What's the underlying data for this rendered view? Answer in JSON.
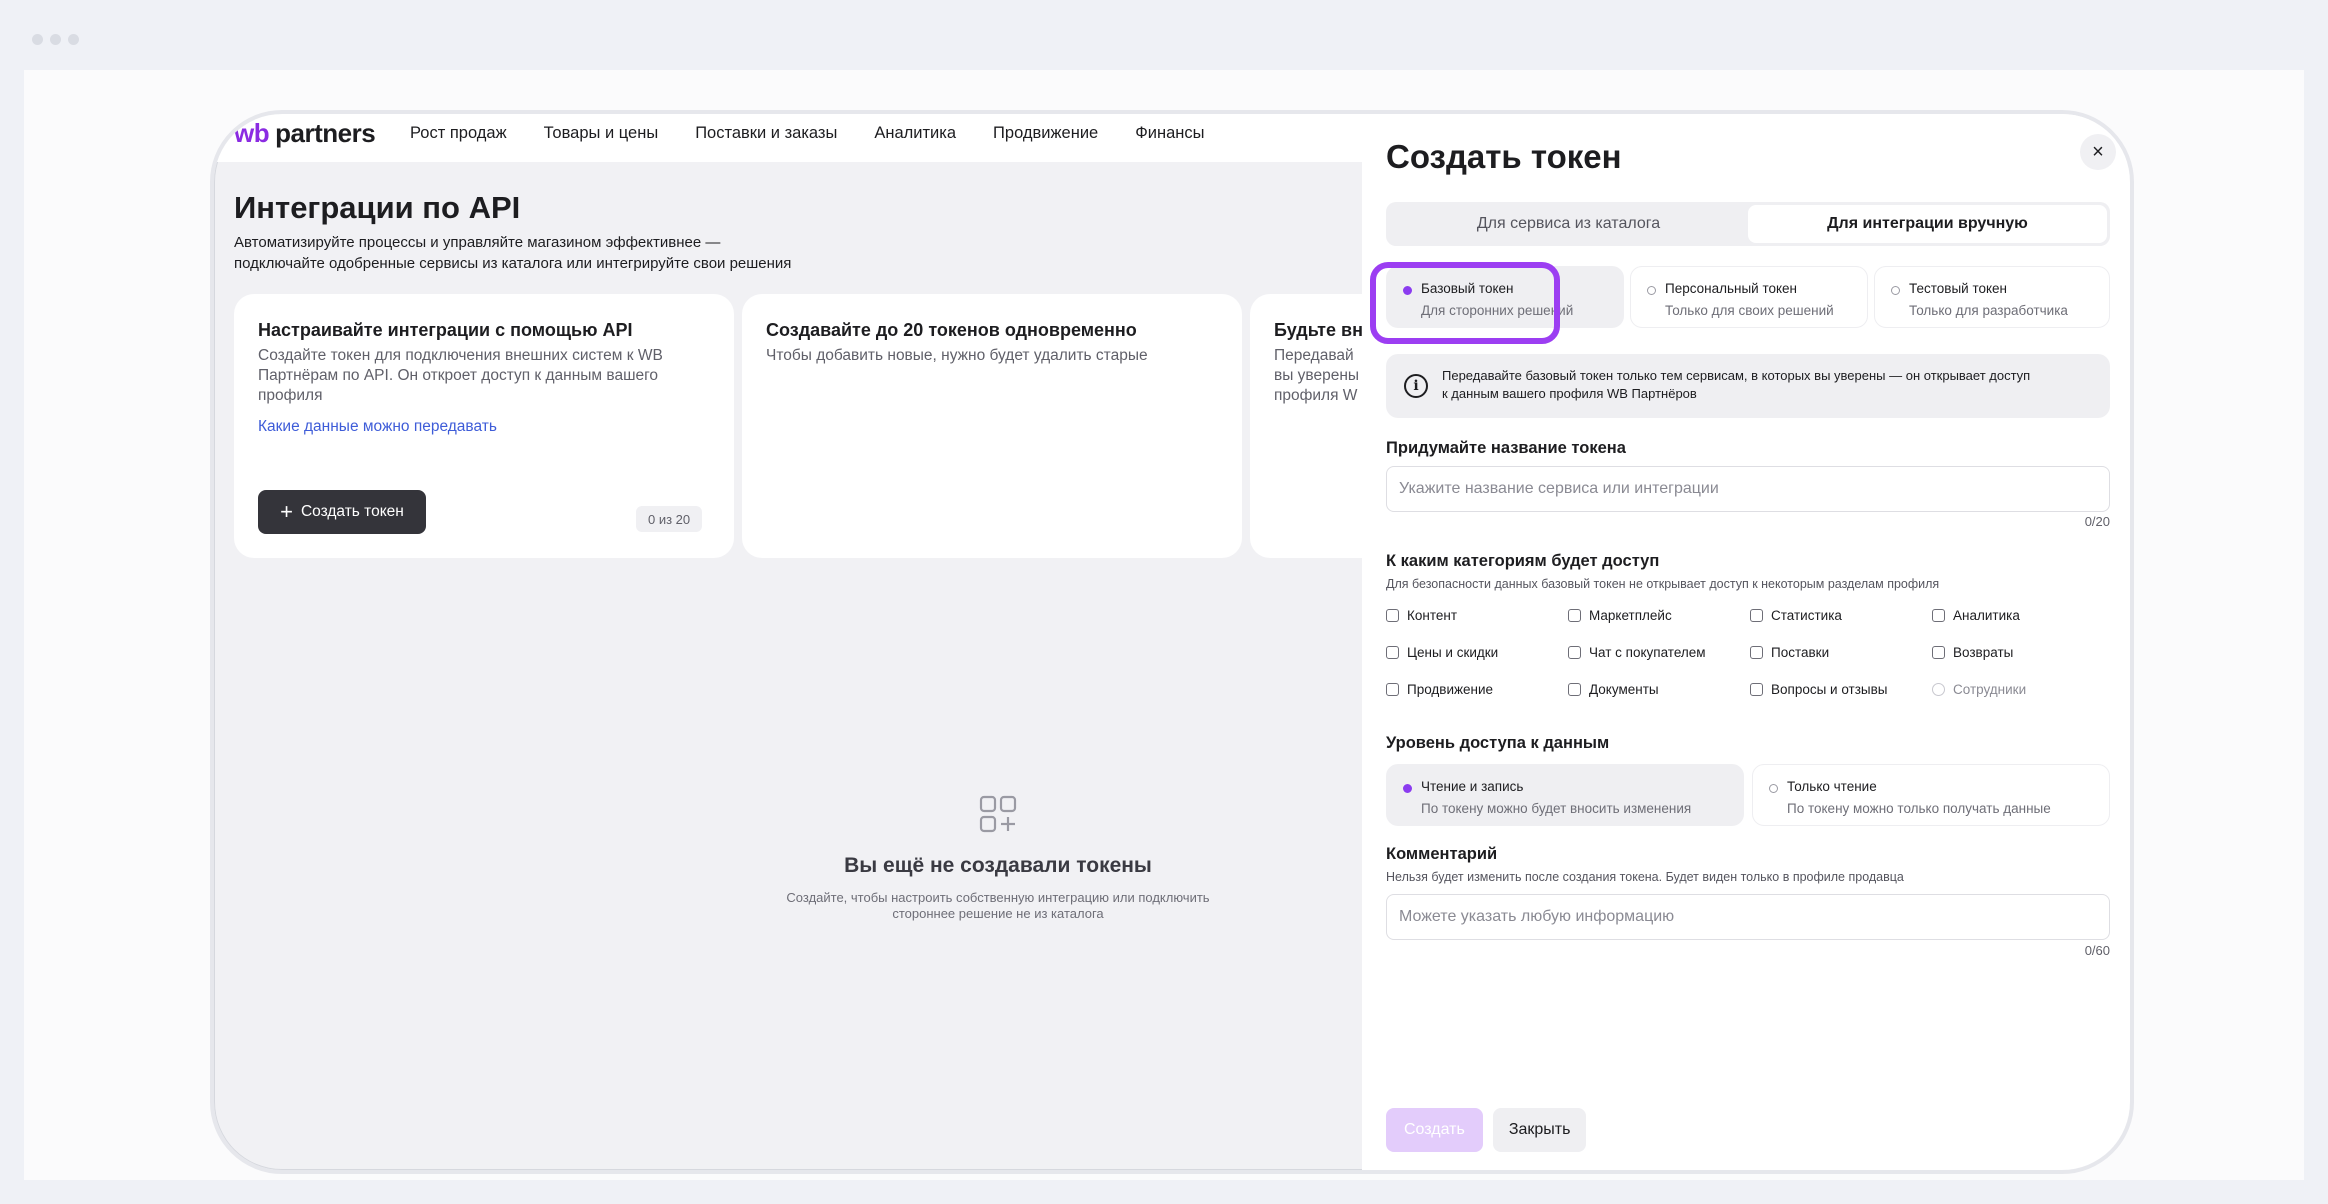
{
  "header": {
    "logo_wb": "wb",
    "logo_partners": "partners",
    "nav": [
      "Рост продаж",
      "Товары и цены",
      "Поставки и заказы",
      "Аналитика",
      "Продвижение",
      "Финансы"
    ]
  },
  "page": {
    "title": "Интеграции по API",
    "subtitle_line1": "Автоматизируйте процессы и управляйте магазином эффективнее —",
    "subtitle_line2": "подключайте одобренные сервисы из каталога или интегрируйте свои решения"
  },
  "cards": [
    {
      "title": "Настраивайте интеграции с помощью API",
      "text": "Создайте токен для подключения внешних систем к WB Партнёрам по API. Он откроет доступ к данным вашего профиля",
      "link": "Какие данные можно передавать",
      "button": "Создать токен",
      "badge": "0 из 20"
    },
    {
      "title": "Создавайте до 20 токенов одновременно",
      "text": "Чтобы добавить новые, нужно будет удалить старые"
    },
    {
      "title": "Будьте вни",
      "text_line1": "Передавай",
      "text_line2": "вы уверены",
      "text_line3": "профиля W"
    }
  ],
  "empty_state": {
    "title": "Вы ещё не создавали токены",
    "subtitle_line1": "Создайте, чтобы настроить собственную интеграцию или подключить",
    "subtitle_line2": "стороннее решение не из каталога"
  },
  "drawer": {
    "title": "Создать токен",
    "close_icon": "×",
    "tabs": [
      "Для сервиса из каталога",
      "Для интеграции вручную"
    ],
    "active_tab": "Для интеграции вручную",
    "token_types": [
      {
        "title": "Базовый токен",
        "sub": "Для сторонних решений",
        "selected": true
      },
      {
        "title": "Персональный токен",
        "sub": "Только для своих решений",
        "selected": false
      },
      {
        "title": "Тестовый токен",
        "sub": "Только для разработчика",
        "selected": false
      }
    ],
    "notice_line1": "Передавайте базовый токен только тем сервисам, в которых вы уверены — он открывает доступ",
    "notice_line2": "к данным вашего профиля WB Партнёров",
    "name_label": "Придумайте название токена",
    "name_placeholder": "Укажите название сервиса или интеграции",
    "name_counter": "0/20",
    "categories_label": "К каким категориям будет доступ",
    "categories_hint": "Для безопасности данных базовый токен не открывает доступ к некоторым разделам профиля",
    "categories": [
      "Контент",
      "Маркетплейс",
      "Статистика",
      "Аналитика",
      "Цены и скидки",
      "Чат с покупателем",
      "Поставки",
      "Возвраты",
      "Продвижение",
      "Документы",
      "Вопросы и отзывы",
      "Сотрудники"
    ],
    "access_label": "Уровень доступа к данным",
    "access_levels": [
      {
        "title": "Чтение и запись",
        "sub": "По токену можно будет вносить изменения",
        "selected": true
      },
      {
        "title": "Только чтение",
        "sub": "По токену можно только получать данные",
        "selected": false
      }
    ],
    "comment_label": "Комментарий",
    "comment_hint": "Нельзя будет изменить после создания токена. Будет виден только в профиле продавца",
    "comment_placeholder": "Можете указать любую информацию",
    "comment_counter": "0/60",
    "create_button": "Создать",
    "close_button": "Закрыть"
  },
  "colors": {
    "accent": "#8b3cf0",
    "highlight": "#9c3ef2",
    "link": "#3e5cd8",
    "dark_button": "#34343a"
  }
}
